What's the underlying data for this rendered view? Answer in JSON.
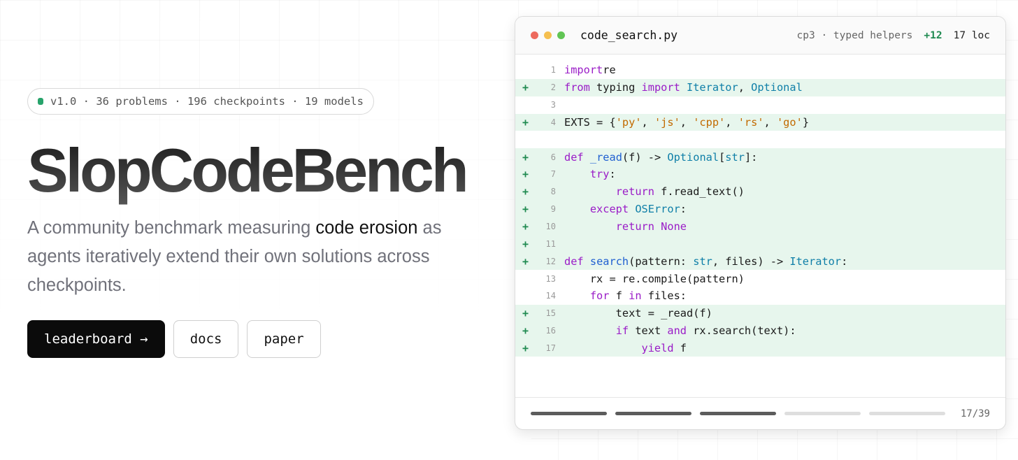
{
  "hero": {
    "pill": "v1.0 · 36 problems · 196 checkpoints · 19 models",
    "title": "SlopCodeBench",
    "subtitle_pre": "A community benchmark measuring ",
    "subtitle_em": "code erosion",
    "subtitle_post": " as agents iteratively extend their own solutions across checkpoints.",
    "buttons": {
      "leaderboard": "leaderboard →",
      "docs": "docs",
      "paper": "paper"
    }
  },
  "editor": {
    "filename": "code_search.py",
    "checkpoint": "cp3 · typed helpers",
    "added": "+12",
    "loc": "17 loc",
    "progress": {
      "segments": 5,
      "completed": 3
    },
    "counter": "17/39",
    "colors": {
      "add_bg": "#e7f6ed",
      "add_marker": "#1f8a50",
      "keyword": "#9a1cc7",
      "function": "#1f5fd1",
      "type": "#0f7fa8",
      "string": "#c26a00"
    },
    "lines": [
      {
        "n": "1",
        "add": false,
        "tokens": [
          [
            "kw",
            "import"
          ],
          [
            "",
            "re"
          ]
        ]
      },
      {
        "n": "2",
        "add": true,
        "tokens": [
          [
            "kw",
            "from"
          ],
          [
            "",
            " typing "
          ],
          [
            "kw",
            "import"
          ],
          [
            "",
            " "
          ],
          [
            "ty",
            "Iterator"
          ],
          [
            "",
            ", "
          ],
          [
            "ty",
            "Optional"
          ]
        ]
      },
      {
        "n": "3",
        "add": false,
        "tokens": []
      },
      {
        "n": "4",
        "add": true,
        "tokens": [
          [
            "",
            "EXTS = {"
          ],
          [
            "st",
            "'py'"
          ],
          [
            "",
            ", "
          ],
          [
            "st",
            "'js'"
          ],
          [
            "",
            ", "
          ],
          [
            "st",
            "'cpp'"
          ],
          [
            "",
            ", "
          ],
          [
            "st",
            "'rs'"
          ],
          [
            "",
            ", "
          ],
          [
            "st",
            "'go'"
          ],
          [
            "",
            "}"
          ]
        ]
      },
      {
        "n": "",
        "add": false,
        "tokens": []
      },
      {
        "n": "6",
        "add": true,
        "tokens": [
          [
            "kw",
            "def"
          ],
          [
            "",
            " "
          ],
          [
            "fn",
            "_read"
          ],
          [
            "",
            "(f) -> "
          ],
          [
            "ty",
            "Optional"
          ],
          [
            "",
            "["
          ],
          [
            "ty",
            "str"
          ],
          [
            "",
            "]:"
          ]
        ]
      },
      {
        "n": "7",
        "add": true,
        "tokens": [
          [
            "",
            "    "
          ],
          [
            "kw",
            "try"
          ],
          [
            "",
            ":"
          ]
        ]
      },
      {
        "n": "8",
        "add": true,
        "tokens": [
          [
            "",
            "        "
          ],
          [
            "kw",
            "return"
          ],
          [
            "",
            " f.read_text()"
          ]
        ]
      },
      {
        "n": "9",
        "add": true,
        "tokens": [
          [
            "",
            "    "
          ],
          [
            "kw",
            "except"
          ],
          [
            "",
            " "
          ],
          [
            "ty",
            "OSError"
          ],
          [
            "",
            ":"
          ]
        ]
      },
      {
        "n": "10",
        "add": true,
        "tokens": [
          [
            "",
            "        "
          ],
          [
            "kw",
            "return"
          ],
          [
            "",
            " "
          ],
          [
            "kw",
            "None"
          ]
        ]
      },
      {
        "n": "11",
        "add": true,
        "tokens": []
      },
      {
        "n": "12",
        "add": true,
        "tokens": [
          [
            "kw",
            "def"
          ],
          [
            "",
            " "
          ],
          [
            "fn",
            "search"
          ],
          [
            "",
            "(pattern: "
          ],
          [
            "ty",
            "str"
          ],
          [
            "",
            ", files) -> "
          ],
          [
            "ty",
            "Iterator"
          ],
          [
            "",
            ":"
          ]
        ]
      },
      {
        "n": "13",
        "add": false,
        "tokens": [
          [
            "",
            "    rx = re.compile(pattern)"
          ]
        ]
      },
      {
        "n": "14",
        "add": false,
        "tokens": [
          [
            "",
            "    "
          ],
          [
            "kw",
            "for"
          ],
          [
            "",
            " f "
          ],
          [
            "kw",
            "in"
          ],
          [
            "",
            " files:"
          ]
        ]
      },
      {
        "n": "15",
        "add": true,
        "tokens": [
          [
            "",
            "        text = _read(f)"
          ]
        ]
      },
      {
        "n": "16",
        "add": true,
        "tokens": [
          [
            "",
            "        "
          ],
          [
            "kw",
            "if"
          ],
          [
            "",
            " text "
          ],
          [
            "kw",
            "and"
          ],
          [
            "",
            " rx.search(text):"
          ]
        ]
      },
      {
        "n": "17",
        "add": true,
        "tokens": [
          [
            "",
            "            "
          ],
          [
            "kw",
            "yield"
          ],
          [
            "",
            " f"
          ]
        ]
      }
    ]
  }
}
